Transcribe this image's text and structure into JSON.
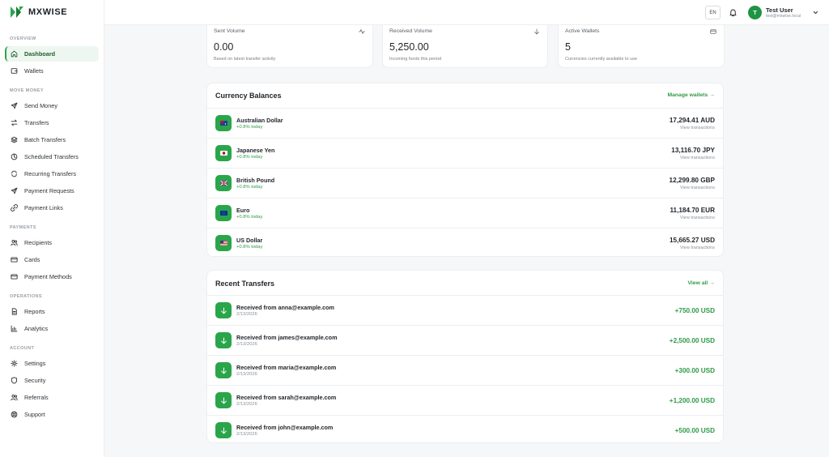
{
  "brand": {
    "name": "MXWISE"
  },
  "nav": {
    "sections": [
      {
        "label": "OVERVIEW",
        "items": [
          {
            "label": "Dashboard",
            "icon": "home-icon",
            "active": true
          },
          {
            "label": "Wallets",
            "icon": "wallet-icon"
          }
        ]
      },
      {
        "label": "MOVE MONEY",
        "items": [
          {
            "label": "Send Money",
            "icon": "send-icon"
          },
          {
            "label": "Transfers",
            "icon": "swap-icon"
          },
          {
            "label": "Batch Transfers",
            "icon": "layers-icon"
          },
          {
            "label": "Scheduled Transfers",
            "icon": "clock-icon"
          },
          {
            "label": "Recurring Transfers",
            "icon": "repeat-icon"
          },
          {
            "label": "Payment Requests",
            "icon": "send-icon"
          },
          {
            "label": "Payment Links",
            "icon": "link-icon"
          }
        ]
      },
      {
        "label": "PAYMENTS",
        "items": [
          {
            "label": "Recipients",
            "icon": "users-icon"
          },
          {
            "label": "Cards",
            "icon": "card-icon"
          },
          {
            "label": "Payment Methods",
            "icon": "card-icon"
          }
        ]
      },
      {
        "label": "OPERATIONS",
        "items": [
          {
            "label": "Reports",
            "icon": "file-icon"
          },
          {
            "label": "Analytics",
            "icon": "bar-chart-icon"
          }
        ]
      },
      {
        "label": "ACCOUNT",
        "items": [
          {
            "label": "Settings",
            "icon": "gear-icon"
          },
          {
            "label": "Security",
            "icon": "shield-icon"
          },
          {
            "label": "Referrals",
            "icon": "users-icon"
          },
          {
            "label": "Support",
            "icon": "lifebuoy-icon"
          }
        ]
      }
    ]
  },
  "header": {
    "lang": "EN",
    "user_name": "Test User",
    "user_email": "test@mxwise.local",
    "avatar_initial": "T"
  },
  "stats": [
    {
      "title": "Sent Volume",
      "value": "0.00",
      "sub": "Based on latest transfer activity",
      "icon": "activity-icon"
    },
    {
      "title": "Received Volume",
      "value": "5,250.00",
      "sub": "Incoming funds this period",
      "icon": "arrow-down-icon"
    },
    {
      "title": "Active Wallets",
      "value": "5",
      "sub": "Currencies currently available to use",
      "icon": "card-icon"
    }
  ],
  "balances": {
    "title": "Currency Balances",
    "link": "Manage wallets →",
    "rows": [
      {
        "name": "Australian Dollar",
        "change": "+0.8% today",
        "amount": "17,294.41 AUD",
        "link": "View transactions",
        "flag": "flag-au-icon"
      },
      {
        "name": "Japanese Yen",
        "change": "+0.8% today",
        "amount": "13,116.70 JPY",
        "link": "View transactions",
        "flag": "flag-jp-icon"
      },
      {
        "name": "British Pound",
        "change": "+0.8% today",
        "amount": "12,299.80 GBP",
        "link": "View transactions",
        "flag": "flag-gb-icon"
      },
      {
        "name": "Euro",
        "change": "+0.8% today",
        "amount": "11,184.70 EUR",
        "link": "View transactions",
        "flag": "flag-eu-icon"
      },
      {
        "name": "US Dollar",
        "change": "+0.8% today",
        "amount": "15,665.27 USD",
        "link": "View transactions",
        "flag": "flag-us-icon"
      }
    ]
  },
  "transfers": {
    "title": "Recent Transfers",
    "link": "View all →",
    "rows": [
      {
        "label": "Received from anna@example.com",
        "date": "2/13/2026",
        "amount": "+750.00 USD"
      },
      {
        "label": "Received from james@example.com",
        "date": "2/13/2026",
        "amount": "+2,500.00 USD"
      },
      {
        "label": "Received from maria@example.com",
        "date": "2/13/2026",
        "amount": "+300.00 USD"
      },
      {
        "label": "Received from sarah@example.com",
        "date": "2/13/2026",
        "amount": "+1,200.00 USD"
      },
      {
        "label": "Received from john@example.com",
        "date": "2/13/2026",
        "amount": "+500.00 USD"
      }
    ]
  },
  "colors": {
    "accent": "#2aa54a",
    "positive": "#2f9a48",
    "active_bg": "#eef7ef"
  }
}
